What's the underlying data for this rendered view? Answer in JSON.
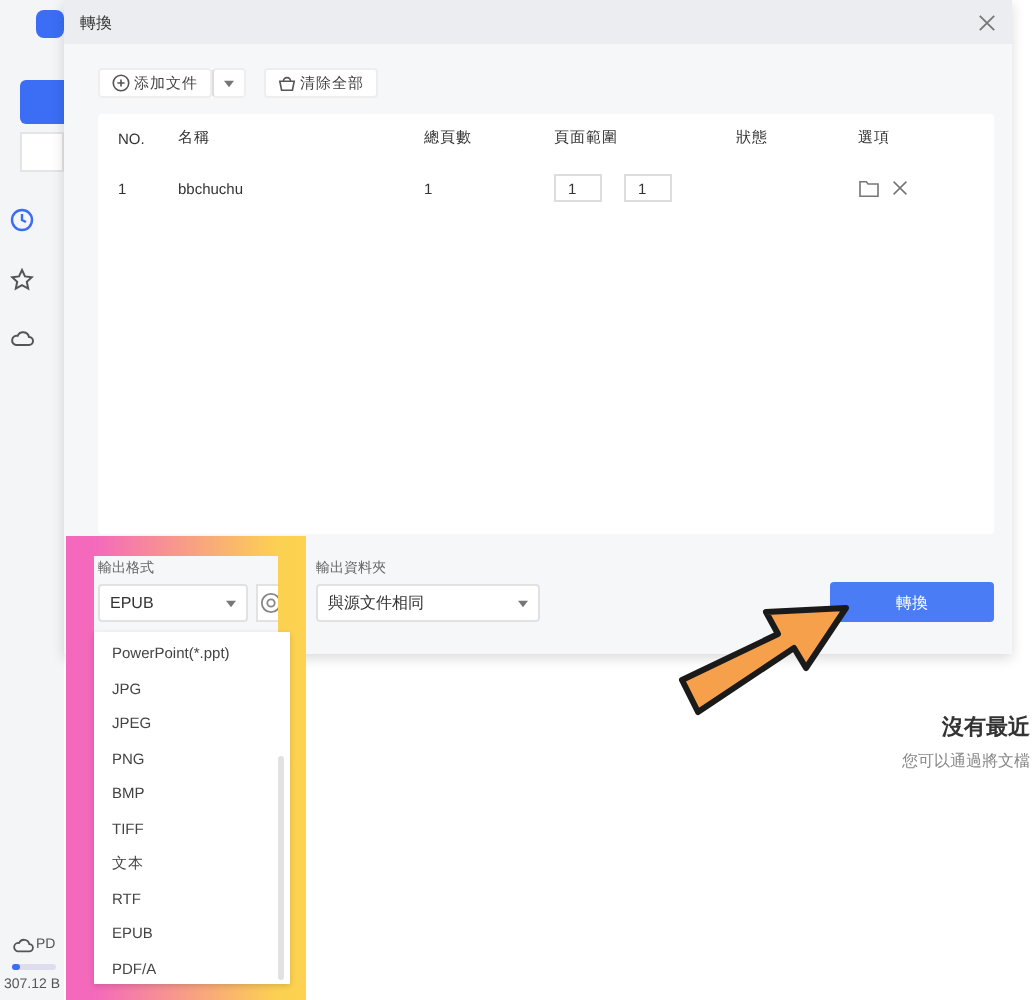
{
  "sidebar": {
    "storage_label": "PD",
    "storage_used": "307.12 B"
  },
  "empty_state": {
    "title": "沒有最近",
    "hint": "您可以通過將文檔"
  },
  "dialog": {
    "title": "轉換",
    "toolbar": {
      "add_button": "添加文件",
      "clear_button": "清除全部"
    },
    "table": {
      "columns": [
        "NO.",
        "名稱",
        "總頁數",
        "頁面範圍",
        "狀態",
        "選項"
      ],
      "rows": [
        {
          "no": "1",
          "name": "bbchuchu",
          "pages": "1",
          "range_from": "1",
          "range_to": "1"
        }
      ]
    },
    "output_format": {
      "label": "輸出格式",
      "value": "EPUB",
      "options": [
        "PowerPoint(*.ppt)",
        "JPG",
        "JPEG",
        "PNG",
        "BMP",
        "TIFF",
        "文本",
        "RTF",
        "EPUB",
        "PDF/A"
      ]
    },
    "output_folder": {
      "label": "輸出資料夾",
      "value": "與源文件相同"
    },
    "convert_button": "轉換"
  }
}
